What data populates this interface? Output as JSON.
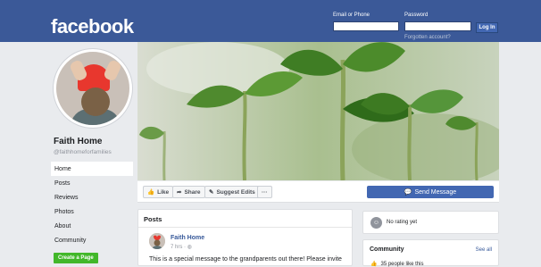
{
  "header": {
    "logo": "facebook",
    "email_label": "Email or Phone",
    "password_label": "Password",
    "login_button": "Log In",
    "forgot_link": "Forgotten account?"
  },
  "page": {
    "name": "Faith Home",
    "handle": "@faithhomeforfamilies"
  },
  "nav": {
    "items": [
      {
        "label": "Home",
        "active": true
      },
      {
        "label": "Posts"
      },
      {
        "label": "Reviews"
      },
      {
        "label": "Photos"
      },
      {
        "label": "About"
      },
      {
        "label": "Community"
      }
    ],
    "create_page": "Create a Page"
  },
  "actions": {
    "like": "Like",
    "share": "Share",
    "suggest_edits": "Suggest Edits",
    "more": "···",
    "send_message": "Send Message"
  },
  "posts": {
    "title": "Posts",
    "author": "Faith Home",
    "time": "7 hrs ·",
    "text": "This is a special message to the grandparents out there! Please invite"
  },
  "rating": {
    "text": "No rating yet"
  },
  "community": {
    "title": "Community",
    "see_all": "See all",
    "likes": "35 people like this"
  },
  "colors": {
    "brand": "#3b5998",
    "button_blue": "#4267b2",
    "create_green": "#42b72a"
  }
}
